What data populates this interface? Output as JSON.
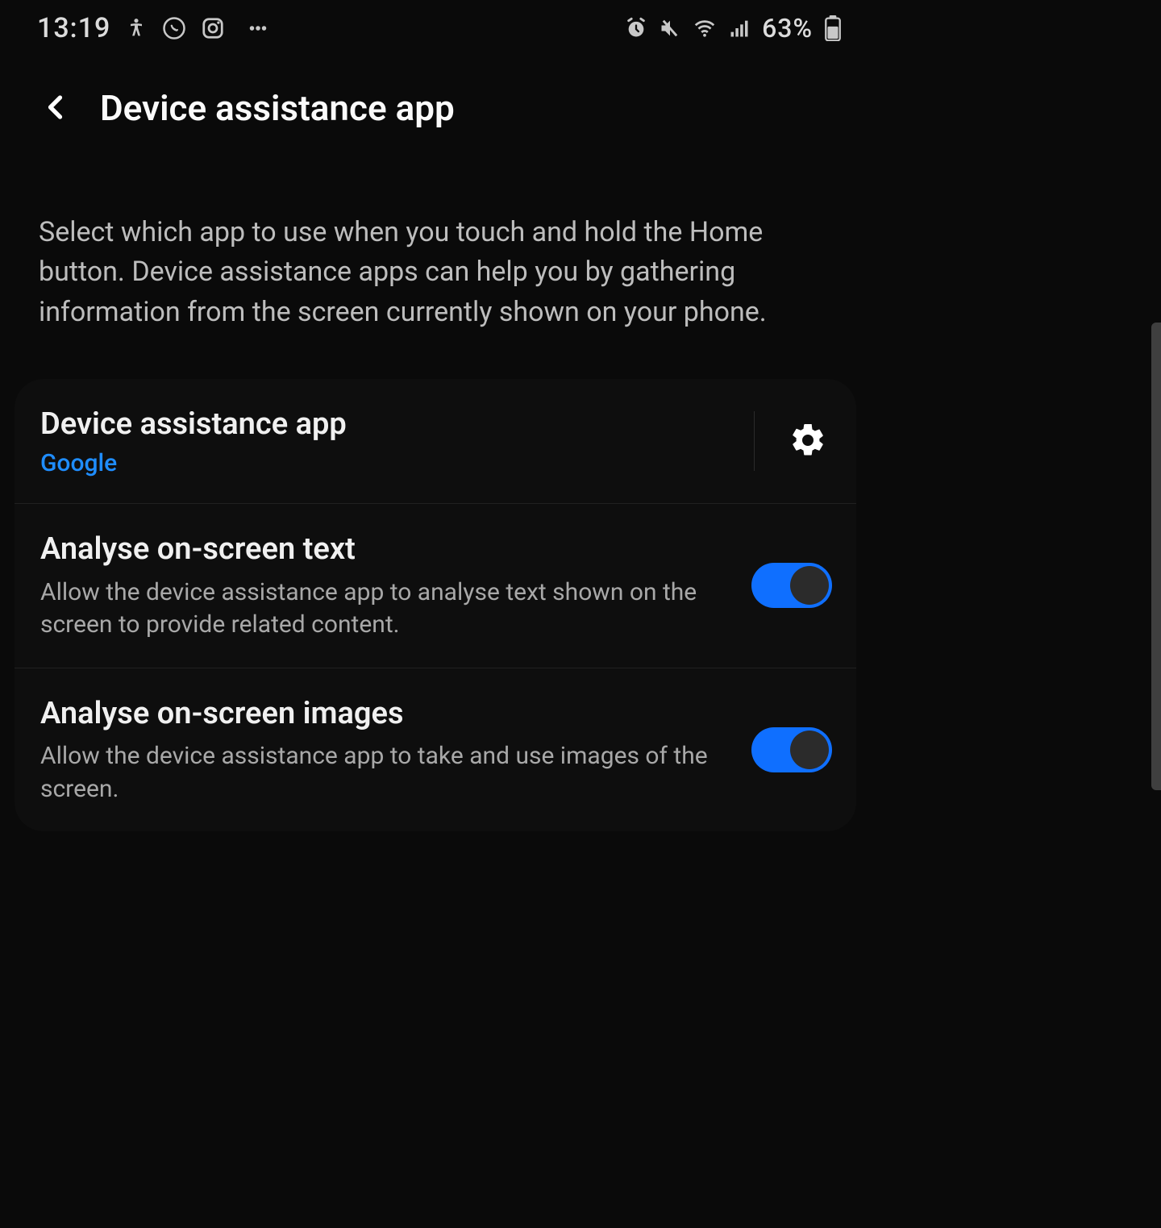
{
  "statusbar": {
    "time": "13:19",
    "battery_percent": "63%"
  },
  "header": {
    "title": "Device assistance app"
  },
  "description": "Select which app to use when you touch and hold the Home button. Device assistance apps can help you by gathering information from the screen currently shown on your phone.",
  "settings": {
    "device_app": {
      "title": "Device assistance app",
      "value": "Google"
    },
    "analyse_text": {
      "title": "Analyse on-screen text",
      "desc": "Allow the device assistance app to analyse text shown on the screen to provide related content.",
      "enabled": true
    },
    "analyse_images": {
      "title": "Analyse on-screen images",
      "desc": "Allow the device assistance app to take and use images of the screen.",
      "enabled": true
    }
  }
}
